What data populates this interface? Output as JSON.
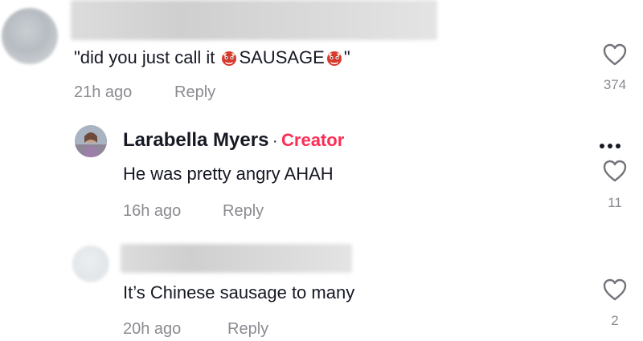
{
  "comments": [
    {
      "text_prefix": "\"did you just call it ",
      "text_middle": "SAUSAGE",
      "text_suffix": "\"",
      "emoji": "ogre-emoji",
      "time": "21h ago",
      "reply_label": "Reply",
      "likes": "374"
    },
    {
      "author": "Larabella Myers",
      "separator": "·",
      "badge": "Creator",
      "text": "He was pretty angry AHAH",
      "time": "16h ago",
      "reply_label": "Reply",
      "likes": "11"
    },
    {
      "text": "It’s Chinese sausage to many",
      "time": "20h ago",
      "reply_label": "Reply",
      "likes": "2"
    }
  ],
  "colors": {
    "creator_badge": "#fe2c55",
    "meta_text": "#8a8b91",
    "primary_text": "#161823"
  },
  "icons": {
    "like": "heart-outline-icon",
    "more": "more-options-icon"
  }
}
